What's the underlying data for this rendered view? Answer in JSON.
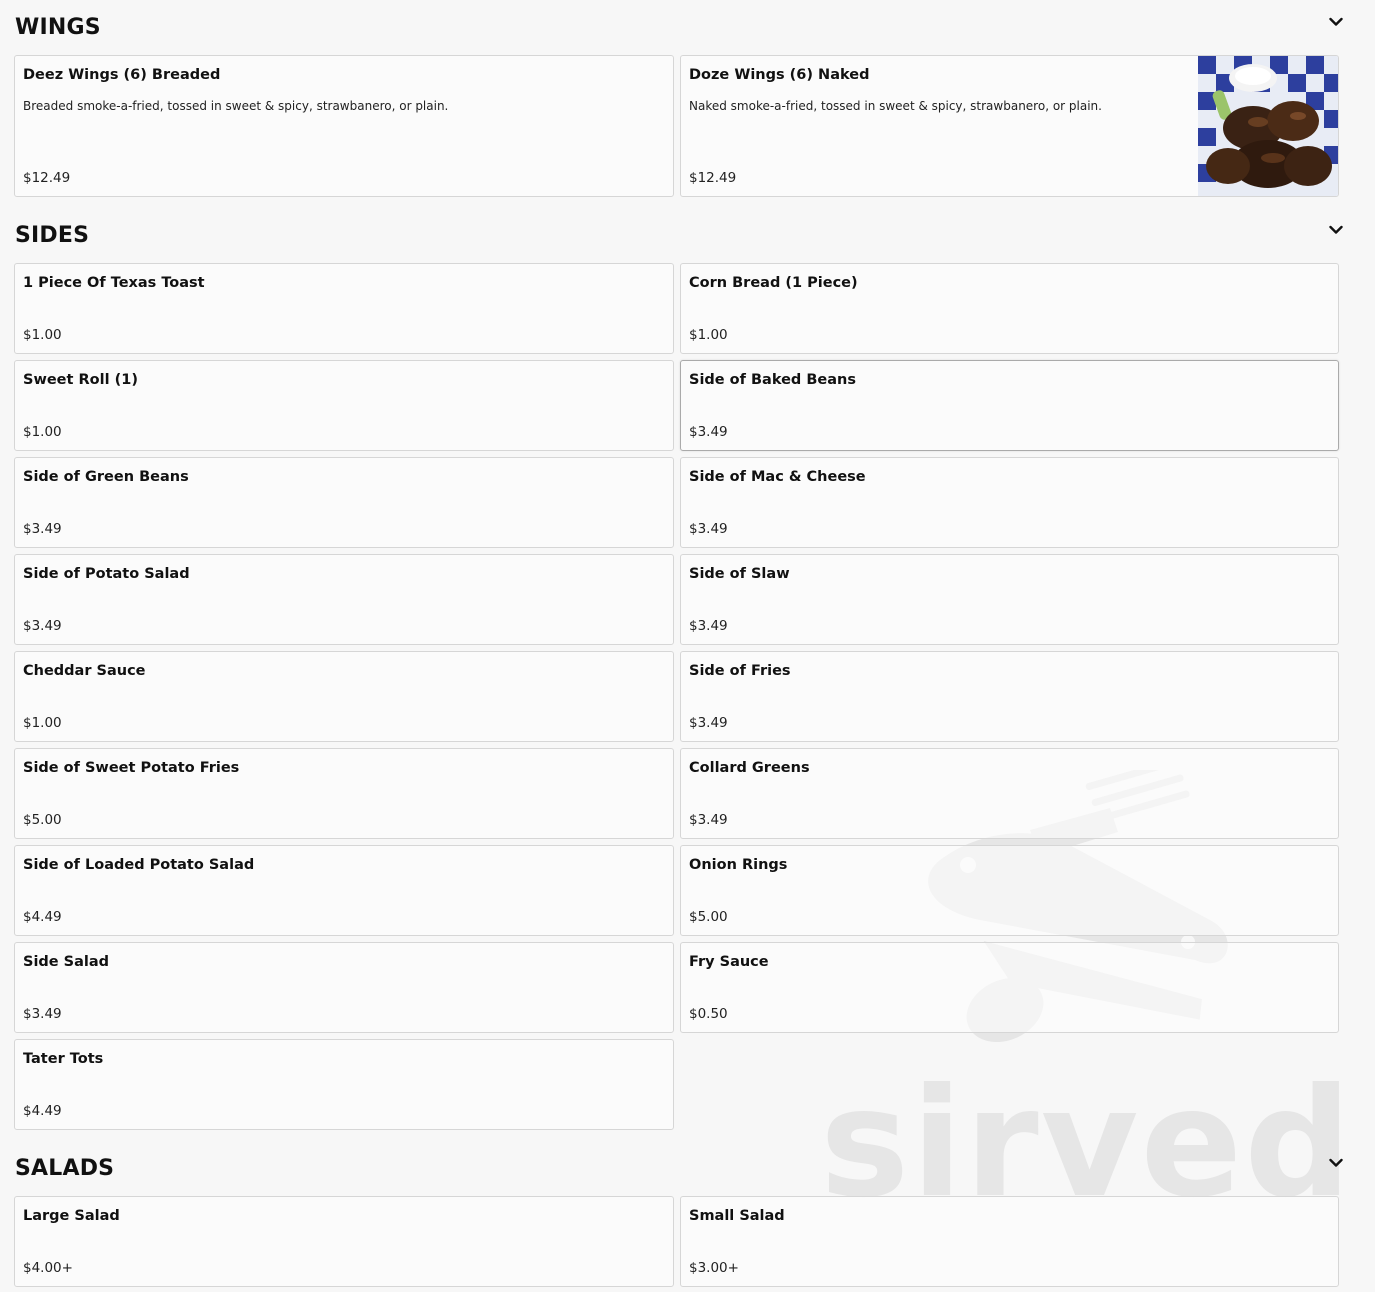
{
  "watermark": {
    "text": "sirved"
  },
  "sections": [
    {
      "title": "WINGS",
      "items": [
        {
          "name": "Deez Wings (6) Breaded",
          "description": "Breaded smoke-a-fried, tossed in sweet & spicy, strawbanero, or plain.",
          "price": "$12.49"
        },
        {
          "name": "Doze Wings (6) Naked",
          "description": "Naked smoke-a-fried, tossed in sweet & spicy, strawbanero, or plain.",
          "price": "$12.49"
        }
      ]
    },
    {
      "title": "SIDES",
      "items": [
        {
          "name": "1 Piece Of Texas Toast",
          "price": "$1.00"
        },
        {
          "name": "Corn Bread (1 Piece)",
          "price": "$1.00"
        },
        {
          "name": "Sweet Roll (1)",
          "price": "$1.00"
        },
        {
          "name": "Side of Baked Beans",
          "price": "$3.49"
        },
        {
          "name": "Side of Green Beans",
          "price": "$3.49"
        },
        {
          "name": "Side of Mac & Cheese",
          "price": "$3.49"
        },
        {
          "name": "Side of Potato Salad",
          "price": "$3.49"
        },
        {
          "name": "Side of Slaw",
          "price": "$3.49"
        },
        {
          "name": "Cheddar Sauce",
          "price": "$1.00"
        },
        {
          "name": "Side of Fries",
          "price": "$3.49"
        },
        {
          "name": "Side of Sweet Potato Fries",
          "price": "$5.00"
        },
        {
          "name": "Collard Greens",
          "price": "$3.49"
        },
        {
          "name": "Side of Loaded Potato Salad",
          "price": "$4.49"
        },
        {
          "name": "Onion Rings",
          "price": "$5.00"
        },
        {
          "name": "Side Salad",
          "price": "$3.49"
        },
        {
          "name": "Fry Sauce",
          "price": "$0.50"
        },
        {
          "name": "Tater Tots",
          "price": "$4.49"
        }
      ]
    },
    {
      "title": "SALADS",
      "items": [
        {
          "name": "Large Salad",
          "price": "$4.00+"
        },
        {
          "name": "Small Salad",
          "price": "$3.00+"
        }
      ]
    }
  ]
}
